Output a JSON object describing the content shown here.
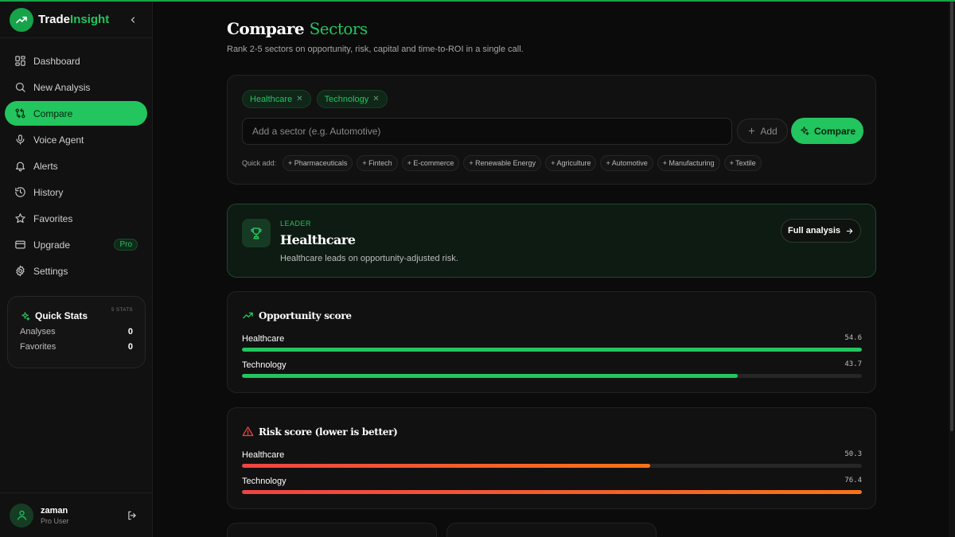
{
  "brand": {
    "name_main": "Trade",
    "name_accent": "Insight"
  },
  "nav": [
    {
      "label": "Dashboard",
      "icon": "grid-icon"
    },
    {
      "label": "New Analysis",
      "icon": "search-icon"
    },
    {
      "label": "Compare",
      "icon": "compare-icon",
      "active": true
    },
    {
      "label": "Voice Agent",
      "icon": "microphone-icon"
    },
    {
      "label": "Alerts",
      "icon": "bell-icon"
    },
    {
      "label": "History",
      "icon": "history-icon"
    },
    {
      "label": "Favorites",
      "icon": "star-icon"
    },
    {
      "label": "Upgrade",
      "icon": "card-icon",
      "badge": "Pro"
    },
    {
      "label": "Settings",
      "icon": "gear-icon"
    }
  ],
  "quick_stats": {
    "title": "Quick Stats",
    "tag": "5 STATS",
    "rows": [
      {
        "label": "Analyses",
        "value": "0"
      },
      {
        "label": "Favorites",
        "value": "0"
      }
    ]
  },
  "user": {
    "name": "zaman",
    "role": "Pro User"
  },
  "page": {
    "title_main": "Compare",
    "title_accent": "Sectors",
    "subtitle": "Rank 2-5 sectors on opportunity, risk, capital and time-to-ROI in a single call."
  },
  "compose": {
    "selected": [
      "Healthcare",
      "Technology"
    ],
    "input_placeholder": "Add a sector (e.g. Automotive)",
    "add_label": "Add",
    "compare_label": "Compare",
    "quick_add_label": "Quick add:",
    "quick_add": [
      "+ Pharmaceuticals",
      "+ Fintech",
      "+ E-commerce",
      "+ Renewable Energy",
      "+ Agriculture",
      "+ Automotive",
      "+ Manufacturing",
      "+ Textile"
    ]
  },
  "leader": {
    "tag": "LEADER",
    "name": "Healthcare",
    "description": "Healthcare leads on opportunity-adjusted risk.",
    "button_label": "Full analysis"
  },
  "metrics": {
    "opportunity": {
      "title": "Opportunity score",
      "max": 54.6,
      "rows": [
        {
          "label": "Healthcare",
          "value": "54.6",
          "fraction": 1.0
        },
        {
          "label": "Technology",
          "value": "43.7",
          "fraction": 0.8
        }
      ]
    },
    "risk": {
      "title": "Risk score (lower is better)",
      "rows": [
        {
          "label": "Healthcare",
          "value": "50.3",
          "fraction": 0.658
        },
        {
          "label": "Technology",
          "value": "76.4",
          "fraction": 1.0
        }
      ]
    }
  },
  "colors": {
    "accent": "#22c55e",
    "risk_start": "#ef4444",
    "risk_end": "#f97316"
  }
}
